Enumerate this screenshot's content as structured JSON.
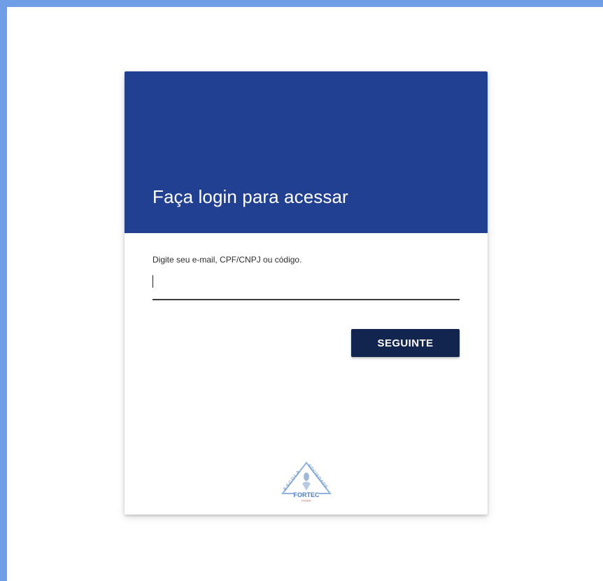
{
  "login": {
    "title": "Faça login para acessar",
    "field_label": "Digite seu e-mail, CPF/CNPJ ou código.",
    "input_value": "",
    "next_button": "SEGUINTE"
  },
  "logo": {
    "text_top_left": "ESCOLA",
    "text_top_right": "SOCIEDADE",
    "text_main": "FORTEC",
    "text_sub": "FATEF"
  },
  "colors": {
    "frame_border": "#6f9ee6",
    "header_bg": "#224092",
    "button_bg": "#12254f"
  }
}
